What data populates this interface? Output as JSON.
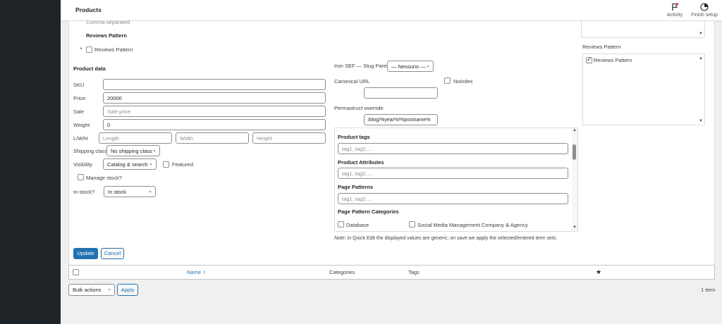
{
  "header": {
    "title": "Products",
    "activity_label": "Activity",
    "finish_setup_label": "Finish setup"
  },
  "top_section": {
    "comma_separated": "Comma-separated",
    "reviews_pattern_heading": "Reviews Pattern",
    "reviews_pattern_checkbox": "Reviews Pattern"
  },
  "product_data": {
    "heading": "Product data",
    "sku_label": "SKU",
    "sku_value": "",
    "price_label": "Price",
    "price_value": "20000",
    "sale_label": "Sale",
    "sale_placeholder": "Sale price",
    "weight_label": "Weight",
    "weight_value": "0",
    "lwh_label": "L/W/H",
    "length_placeholder": "Length",
    "width_placeholder": "Width",
    "height_placeholder": "Height",
    "shipping_label": "Shipping class",
    "shipping_value": "No shipping class",
    "visibility_label": "Visibility",
    "visibility_value": "Catalog & search",
    "featured_label": "Featured",
    "manage_stock_label": "Manage stock?",
    "in_stock_label": "In stock?",
    "in_stock_value": "In stock"
  },
  "seo": {
    "slug_parent_label": "Iron SEF — Slug Parent",
    "slug_parent_value": "— Nessuno —",
    "canonical_label": "Canonical URL",
    "canonical_value": "",
    "noindex_label": "Noindex",
    "permastruct_label": "Permastruct override",
    "permastruct_value": "/blog/%year%/%postname%"
  },
  "taxonomies": {
    "product_tags_heading": "Product tags",
    "product_tags_placeholder": "tag1, tag2, ...",
    "product_attributes_heading": "Product Attributes",
    "product_attributes_placeholder": "tag1, tag2, ...",
    "page_patterns_heading": "Page Patterns",
    "page_patterns_placeholder": "tag1, tag2, ...",
    "page_pattern_categories_heading": "Page Pattern Categories",
    "category_database": "Database",
    "category_social": "Social Media Management Company & Agency"
  },
  "note": {
    "prefix": "Note:",
    "text": " in Quick Edit the displayed values are generic; on save we apply the selected/entered term sets."
  },
  "right_panel": {
    "reviews_pattern_heading": "Reviews Pattern",
    "reviews_pattern_checkbox": "Reviews Pattern"
  },
  "actions": {
    "update_label": "Update",
    "cancel_label": "Cancel"
  },
  "table": {
    "col_name": "Name",
    "col_categories": "Categories",
    "col_tags": "Tags",
    "col_featured": "★"
  },
  "footer": {
    "bulk_actions": "Bulk actions",
    "apply_label": "Apply",
    "item_count": "1 item"
  }
}
